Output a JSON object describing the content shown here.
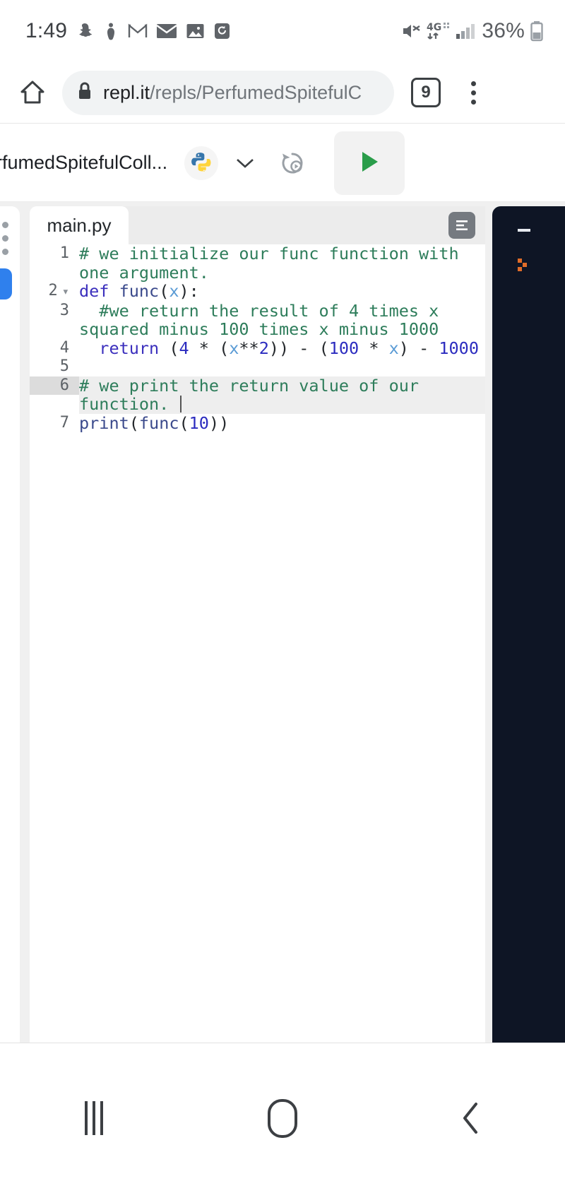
{
  "statusbar": {
    "time": "1:49",
    "icons": [
      "snapchat-icon",
      "person-icon",
      "gmail-icon",
      "envelope-icon",
      "photos-icon",
      "sync-icon"
    ],
    "mute_icon": "mute-icon",
    "network": "4G",
    "signal_icon": "signal-bars-icon",
    "battery_percent": "36%",
    "battery_icon": "battery-icon"
  },
  "browser": {
    "home_icon": "home-icon",
    "lock_icon": "lock-icon",
    "url_domain": "repl.it",
    "url_path": "/repls/PerfumedSpitefulC",
    "tab_count": "9",
    "menu_icon": "overflow-menu-icon"
  },
  "repl_toolbar": {
    "title": "rfumedSpitefulColl...",
    "language_icon": "python-logo-icon",
    "chevron_icon": "chevron-down-icon",
    "history_icon": "history-icon",
    "run_icon": "play-icon",
    "colors": {
      "python_blue": "#3776AB",
      "python_yellow": "#FFD43B",
      "run_green": "#2a9d4a"
    }
  },
  "sidebar": {
    "menu_icon": "vertical-dots-icon",
    "active_item": "sidebar-active-indicator",
    "accent": "#2f80ed"
  },
  "editor": {
    "tab_label": "main.py",
    "format_icon": "format-lines-icon",
    "lines": [
      {
        "number": "1",
        "fold": false,
        "active": false,
        "tokens": [
          {
            "t": "cmt",
            "s": "# we initialize our func function with one argument."
          }
        ]
      },
      {
        "number": "2",
        "fold": true,
        "active": false,
        "tokens": [
          {
            "t": "kw",
            "s": "def"
          },
          {
            "t": "pln",
            "s": " "
          },
          {
            "t": "fn",
            "s": "func"
          },
          {
            "t": "pln",
            "s": "("
          },
          {
            "t": "var",
            "s": "x"
          },
          {
            "t": "pln",
            "s": "):"
          }
        ]
      },
      {
        "number": "3",
        "fold": false,
        "active": false,
        "tokens": [
          {
            "t": "cmt",
            "s": "  #we return the result of 4 times x squared minus 100 times x minus 1000"
          }
        ]
      },
      {
        "number": "4",
        "fold": false,
        "active": false,
        "tokens": [
          {
            "t": "pln",
            "s": "  "
          },
          {
            "t": "kw",
            "s": "return"
          },
          {
            "t": "pln",
            "s": " ("
          },
          {
            "t": "num",
            "s": "4"
          },
          {
            "t": "pln",
            "s": " * ("
          },
          {
            "t": "var",
            "s": "x"
          },
          {
            "t": "pln",
            "s": "**"
          },
          {
            "t": "num",
            "s": "2"
          },
          {
            "t": "pln",
            "s": ")) - ("
          },
          {
            "t": "num",
            "s": "100"
          },
          {
            "t": "pln",
            "s": " * "
          },
          {
            "t": "var",
            "s": "x"
          },
          {
            "t": "pln",
            "s": ") - "
          },
          {
            "t": "num",
            "s": "1000"
          }
        ]
      },
      {
        "number": "5",
        "fold": false,
        "active": false,
        "tokens": [
          {
            "t": "pln",
            "s": ""
          }
        ]
      },
      {
        "number": "6",
        "fold": false,
        "active": true,
        "caret": true,
        "tokens": [
          {
            "t": "cmt",
            "s": "# we print the return value of our function. "
          }
        ]
      },
      {
        "number": "7",
        "fold": false,
        "active": false,
        "tokens": [
          {
            "t": "fn",
            "s": "print"
          },
          {
            "t": "pln",
            "s": "("
          },
          {
            "t": "fn",
            "s": "func"
          },
          {
            "t": "pln",
            "s": "("
          },
          {
            "t": "num",
            "s": "10"
          },
          {
            "t": "pln",
            "s": "))"
          }
        ]
      }
    ],
    "syntax_colors": {
      "comment": "#2e7d5b",
      "keyword": "#3b2fbd",
      "function": "#3b4a8c",
      "variable": "#5a9bd5",
      "number": "#2b2bbf",
      "plain": "#23272b"
    }
  },
  "console": {
    "background": "#0e1525",
    "dash": "-",
    "prompt_glyph": "prompt-icon",
    "prompt_color": "#e06c29"
  },
  "navbar": {
    "recents_icon": "recents-icon",
    "home_icon": "home-button-icon",
    "back_icon": "back-chevron-icon"
  }
}
